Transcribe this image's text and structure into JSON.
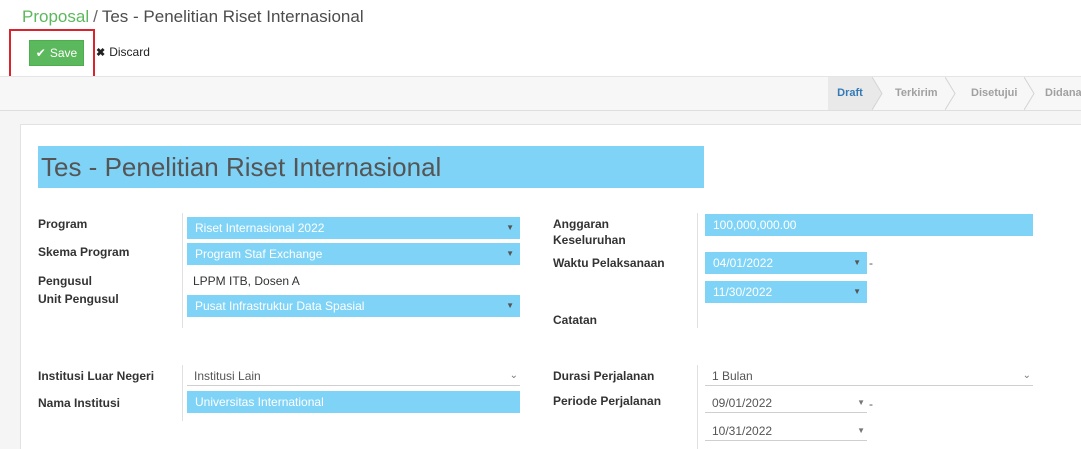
{
  "breadcrumb": {
    "parent": "Proposal",
    "separator": "/",
    "current": "Tes - Penelitian Riset Internasional"
  },
  "toolbar": {
    "save_label": "Save",
    "discard_label": "Discard"
  },
  "statusbar": {
    "stages": [
      "Draft",
      "Terkirim",
      "Disetujui",
      "Didana"
    ],
    "active": "Draft"
  },
  "form": {
    "title": "Tes - Penelitian Riset Internasional",
    "labels": {
      "program": "Program",
      "skema": "Skema Program",
      "pengusul": "Pengusul",
      "unit": "Unit Pengusul",
      "anggaran_1": "Anggaran",
      "anggaran_2": "Keseluruhan",
      "waktu": "Waktu Pelaksanaan",
      "catatan": "Catatan",
      "institusi": "Institusi Luar Negeri",
      "nama_institusi": "Nama Institusi",
      "durasi": "Durasi Perjalanan",
      "periode": "Periode Perjalanan"
    },
    "values": {
      "program": "Riset Internasional 2022",
      "skema": "Program Staf Exchange",
      "pengusul": "LPPM ITB, Dosen A",
      "unit": "Pusat Infrastruktur Data Spasial",
      "anggaran": "100,000,000.00",
      "waktu_start": "04/01/2022",
      "waktu_end": "11/30/2022",
      "institusi": "Institusi Lain",
      "nama_institusi": "Universitas International",
      "durasi": "1 Bulan",
      "periode_start": "09/01/2022",
      "periode_end": "10/31/2022"
    },
    "date_separator": "-"
  },
  "colors": {
    "required_field": "#7fd3f7",
    "save_button": "#5cb85c",
    "highlight": "#d9232d",
    "active_stage": "#337ab7"
  }
}
